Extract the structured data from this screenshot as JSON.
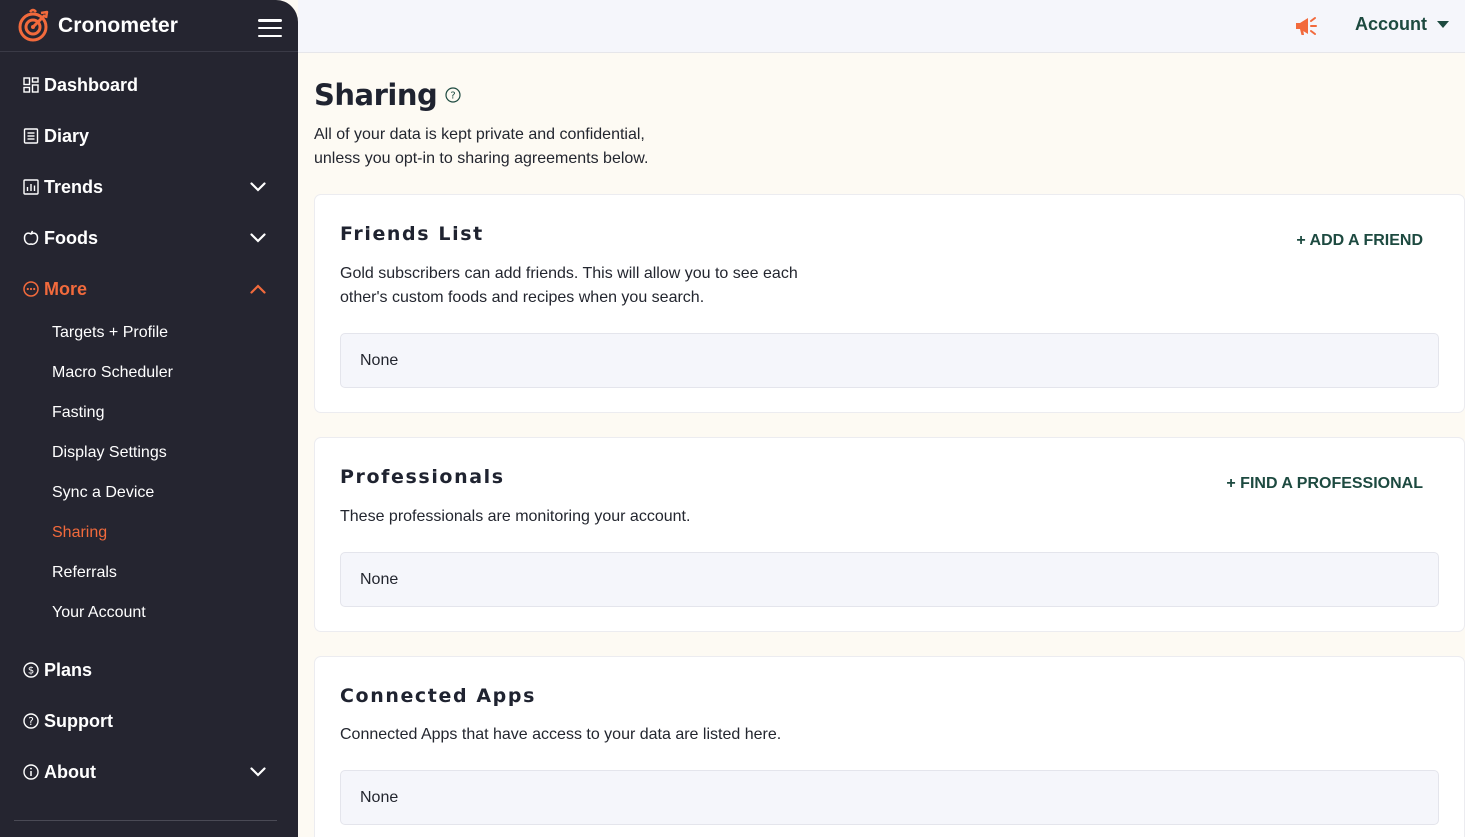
{
  "brand": {
    "name": "Cronometer"
  },
  "sidebar": {
    "items": [
      {
        "label": "Dashboard",
        "icon": "dashboard-grid-icon"
      },
      {
        "label": "Diary",
        "icon": "diary-list-icon"
      },
      {
        "label": "Trends",
        "icon": "bar-chart-icon"
      },
      {
        "label": "Foods",
        "icon": "apple-icon"
      },
      {
        "label": "More",
        "icon": "more-dots-icon"
      },
      {
        "label": "Plans",
        "icon": "dollar-circle-icon"
      },
      {
        "label": "Support",
        "icon": "question-circle-icon"
      },
      {
        "label": "About",
        "icon": "info-circle-icon"
      }
    ],
    "more_submenu": [
      "Targets + Profile",
      "Macro Scheduler",
      "Fasting",
      "Display Settings",
      "Sync a Device",
      "Sharing",
      "Referrals",
      "Your Account"
    ],
    "active_item": "More",
    "active_subitem": "Sharing"
  },
  "topbar": {
    "account_label": "Account"
  },
  "page": {
    "title": "Sharing",
    "description": "All of your data is kept private and confidential, unless you opt-in to sharing agreements below."
  },
  "sections": {
    "friends": {
      "title": "Friends List",
      "action": "+ ADD A FRIEND",
      "description": "Gold subscribers can add friends. This will allow you to see each other's custom foods and recipes when you search.",
      "empty": "None"
    },
    "professionals": {
      "title": "Professionals",
      "action": "+ FIND A PROFESSIONAL",
      "description": "These professionals are monitoring your account.",
      "empty": "None"
    },
    "apps": {
      "title": "Connected Apps",
      "description": "Connected Apps that have access to your data are listed here.",
      "empty": "None"
    }
  },
  "colors": {
    "sidebar_bg": "#252530",
    "accent_orange": "#f26a3c",
    "accent_green": "#1d4a40",
    "page_bg": "#fdfaf3"
  }
}
